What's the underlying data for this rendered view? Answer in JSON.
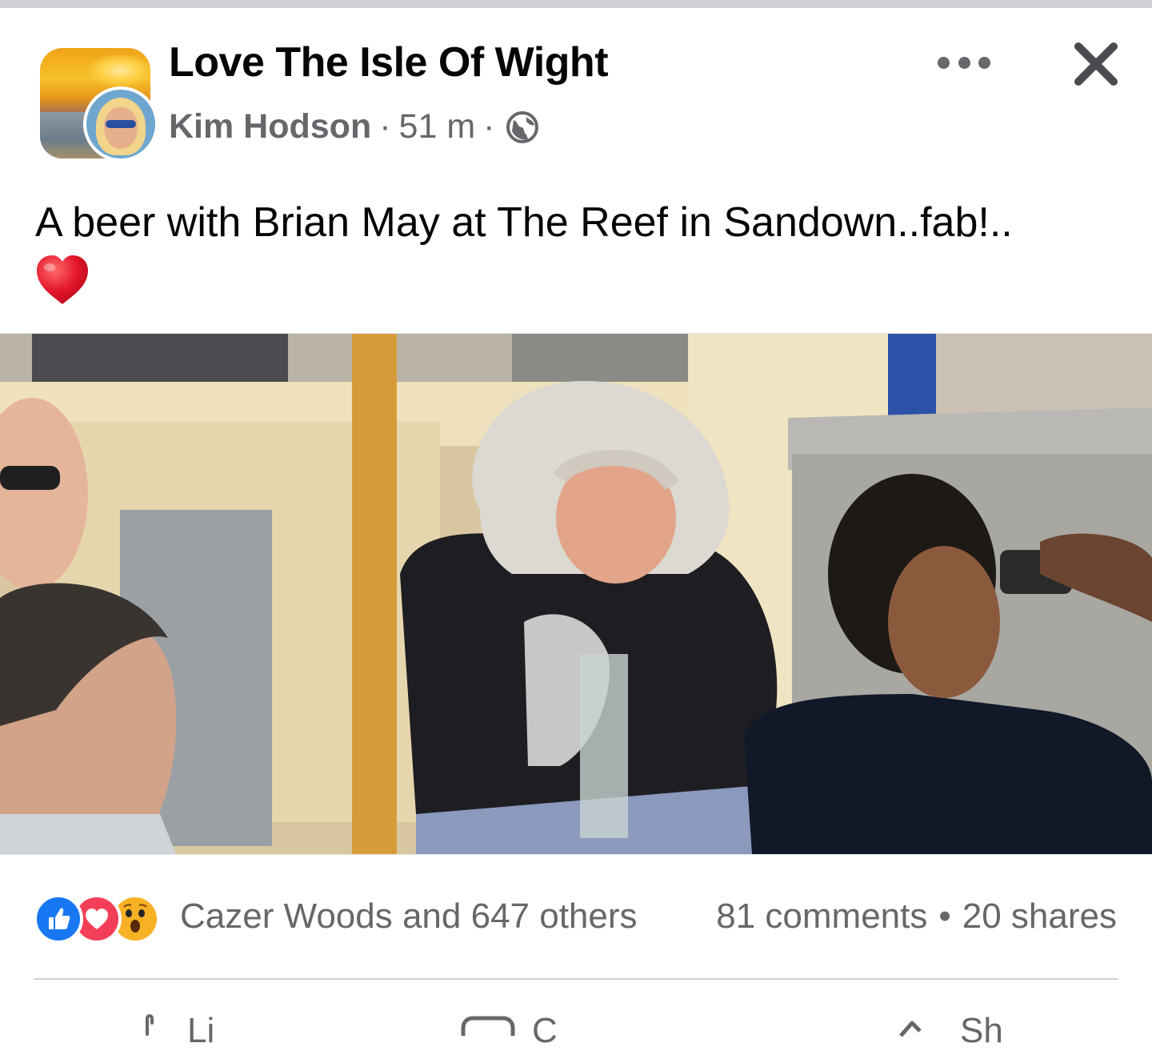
{
  "header": {
    "page_name": "Love The Isle Of Wight",
    "author": "Kim Hodson",
    "time": "51 m",
    "separator": "·",
    "privacy_icon": "globe-icon",
    "more_icon": "more-horizontal-icon",
    "close_icon": "close-icon"
  },
  "post": {
    "text": "A beer with Brian May at The Reef in Sandown..fab!..",
    "emoji": "heart-emoji"
  },
  "engagement": {
    "reaction_icons": [
      "like-icon",
      "love-icon",
      "wow-icon"
    ],
    "reaction_text": "Cazer Woods and 647 others",
    "comments": "81 comments",
    "separator": "•",
    "shares": "20 shares"
  },
  "actions": [
    {
      "icon": "thumbs-up-icon",
      "label": "Li"
    },
    {
      "icon": "comment-icon",
      "label": "C"
    },
    {
      "icon": "share-icon",
      "label": "Sh"
    }
  ],
  "colors": {
    "text_primary": "#050505",
    "text_secondary": "#65676b",
    "like_blue": "#1877f2",
    "love_red": "#f33e58",
    "wow_yellow": "#f7b125",
    "divider": "#ced0d4"
  }
}
